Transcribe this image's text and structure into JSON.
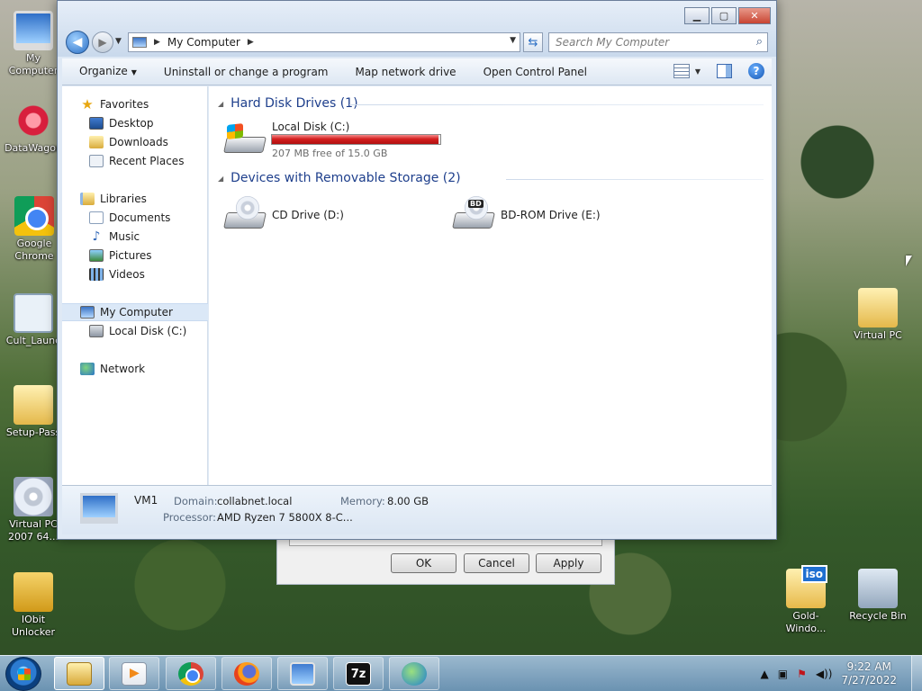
{
  "desktop": {
    "icons_left": [
      {
        "label": "My Computer",
        "icon": "computer-icon"
      },
      {
        "label": "DataWagon",
        "icon": "gear-icon"
      },
      {
        "label": "Google Chrome",
        "icon": "chrome-icon"
      },
      {
        "label": "Cult_Launc",
        "icon": "window-icon"
      },
      {
        "label": "Setup-Pass",
        "icon": "folder-icon"
      },
      {
        "label": "Virtual PC 2007 64...",
        "icon": "disc-icon"
      },
      {
        "label": "IObit Unlocker",
        "icon": "lock-icon"
      }
    ],
    "icons_right": [
      {
        "label": "Virtual PC",
        "icon": "folder-icon"
      },
      {
        "label": "Gold-Windo...",
        "icon": "iso-icon"
      },
      {
        "label": "Recycle Bin",
        "icon": "recycle-bin-icon"
      }
    ]
  },
  "window": {
    "address": {
      "crumb": "My Computer"
    },
    "search_placeholder": "Search My Computer",
    "toolbar": {
      "organize": "Organize",
      "uninstall": "Uninstall or change a program",
      "map_drive": "Map network drive",
      "control_panel": "Open Control Panel"
    },
    "nav": {
      "favorites": "Favorites",
      "desktop": "Desktop",
      "downloads": "Downloads",
      "recent": "Recent Places",
      "libraries": "Libraries",
      "documents": "Documents",
      "music": "Music",
      "pictures": "Pictures",
      "videos": "Videos",
      "my_computer": "My Computer",
      "local_disk": "Local Disk (C:)",
      "network": "Network"
    },
    "groups": {
      "hdd": "Hard Disk Drives (1)",
      "removable": "Devices with Removable Storage (2)"
    },
    "drives": {
      "c": {
        "name": "Local Disk (C:)",
        "free": "207 MB free of 15.0 GB",
        "used_fraction": 0.987
      },
      "d": {
        "name": "CD Drive (D:)"
      },
      "e": {
        "name": "BD-ROM Drive (E:)",
        "badge": "BD"
      }
    },
    "details": {
      "name": "VM1",
      "domain_label": "Domain:",
      "domain": "collabnet.local",
      "memory_label": "Memory:",
      "memory": "8.00 GB",
      "processor_label": "Processor:",
      "processor": "AMD Ryzen 7 5800X 8-C..."
    }
  },
  "dialog": {
    "ok": "OK",
    "cancel": "Cancel",
    "apply": "Apply"
  },
  "taskbar": {
    "apps": [
      "explorer-icon",
      "media-center-icon",
      "chrome-icon",
      "firefox-icon",
      "virtual-pc-icon",
      "7zip-icon",
      "idm-icon"
    ],
    "time": "9:22 AM",
    "date": "7/27/2022"
  },
  "colors": {
    "drive_bar_full": "#d41f1f",
    "group_header": "#1e3f8c"
  }
}
